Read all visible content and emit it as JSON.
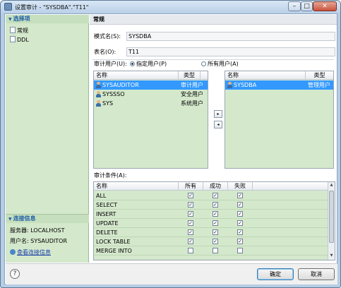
{
  "window": {
    "title": "设置审计 - \"SYSDBA\".\"T11\"",
    "controls": {
      "minimize": "–",
      "maximize": "□",
      "close": "✕"
    }
  },
  "left_panel": {
    "options_header": "选择项",
    "nav_items": [
      "常规",
      "DDL"
    ],
    "connection_header": "连接信息",
    "server_line": "服务器: LOCALHOST",
    "user_line": "用户名: SYSAUDITOR",
    "view_conn_link": "查看连接信息"
  },
  "right_panel": {
    "section_title": "常规",
    "schema_label": "模式名(S):",
    "schema_value": "SYSDBA",
    "table_label": "表名(O):",
    "table_value": "T11",
    "audit_user_label": "审计用户(U):",
    "radio_specified": "指定用户(P)",
    "radio_all": "所有用户(A)",
    "radio_selected": "specified",
    "available_users": {
      "headers": [
        "名称",
        "类型"
      ],
      "rows": [
        {
          "name": "SYSAUDITOR",
          "type": "审计用户",
          "selected": true
        },
        {
          "name": "SYSSSO",
          "type": "安全用户",
          "selected": false
        },
        {
          "name": "SYS",
          "type": "系统用户",
          "selected": false
        }
      ]
    },
    "move_buttons": {
      "add": "▸",
      "remove": "◂"
    },
    "selected_users": {
      "headers": [
        "名称",
        "类型"
      ],
      "rows": [
        {
          "name": "SYSDBA",
          "type": "管理用户",
          "selected": true
        }
      ]
    },
    "conditions_label": "审计条件(A):",
    "conditions": {
      "headers": [
        "名称",
        "所有",
        "成功",
        "失败"
      ],
      "rows": [
        {
          "name": "ALL",
          "all": true,
          "success": true,
          "fail": true
        },
        {
          "name": "SELECT",
          "all": true,
          "success": true,
          "fail": true
        },
        {
          "name": "INSERT",
          "all": true,
          "success": true,
          "fail": true
        },
        {
          "name": "UPDATE",
          "all": true,
          "success": true,
          "fail": true
        },
        {
          "name": "DELETE",
          "all": true,
          "success": true,
          "fail": true
        },
        {
          "name": "LOCK TABLE",
          "all": true,
          "success": true,
          "fail": true
        },
        {
          "name": "MERGE INTO",
          "all": false,
          "success": false,
          "fail": false
        }
      ]
    }
  },
  "footer": {
    "help": "?",
    "ok": "确定",
    "cancel": "取消"
  },
  "colors": {
    "panel_green": "#d4e8cc",
    "selection_blue": "#3399ff",
    "link_blue": "#1a3fa8"
  }
}
